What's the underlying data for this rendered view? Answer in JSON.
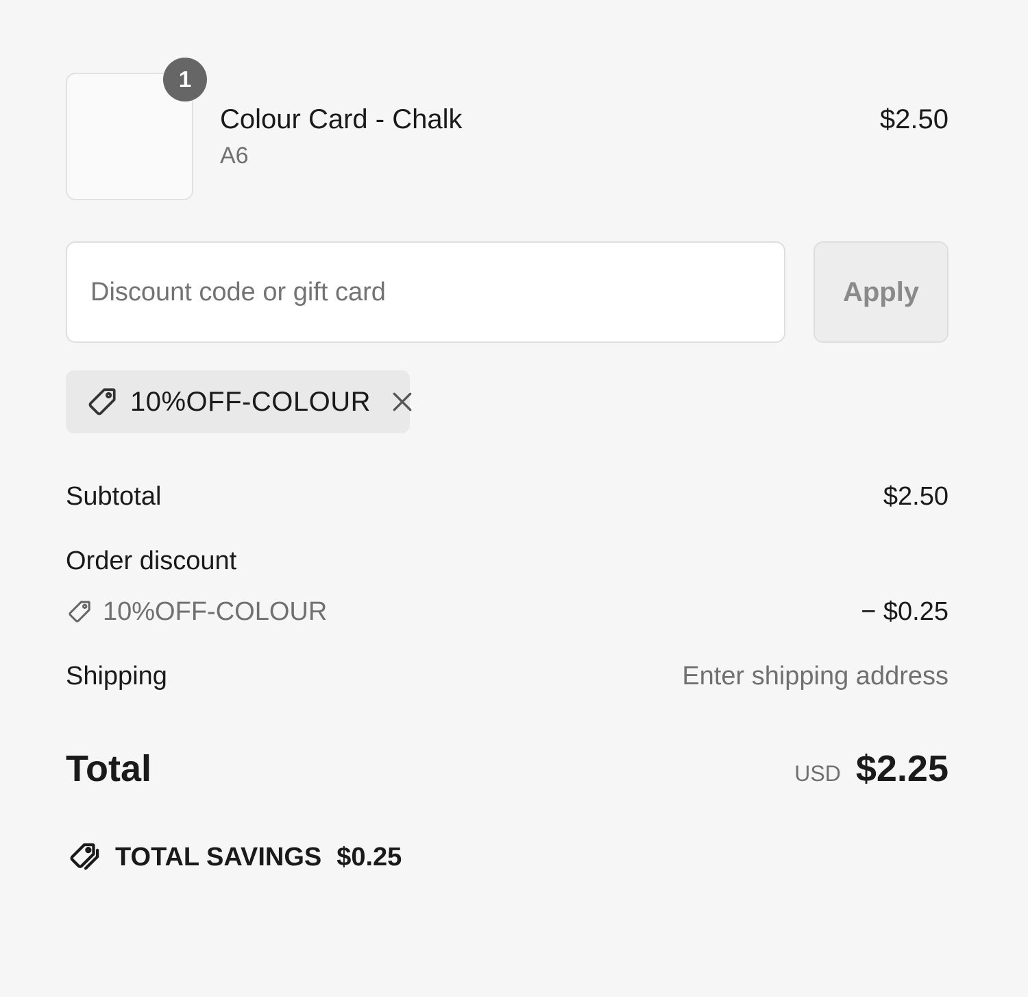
{
  "line_item": {
    "quantity": "1",
    "title": "Colour Card - Chalk",
    "variant": "A6",
    "price": "$2.50"
  },
  "discount_form": {
    "placeholder": "Discount code or gift card",
    "value": "",
    "apply_label": "Apply"
  },
  "applied_code": {
    "code": "10%OFF-COLOUR",
    "icon": "tag-icon",
    "remove_icon": "close-icon"
  },
  "totals": {
    "subtotal_label": "Subtotal",
    "subtotal_value": "$2.50",
    "order_discount_label": "Order discount",
    "order_discount_code": "10%OFF-COLOUR",
    "order_discount_value": "− $0.25",
    "shipping_label": "Shipping",
    "shipping_value": "Enter shipping address",
    "total_label": "Total",
    "currency": "USD",
    "total_value": "$2.25"
  },
  "savings": {
    "label": "TOTAL SAVINGS",
    "value": "$0.25",
    "icon": "double-tag-icon"
  },
  "colors": {
    "background": "#f6f6f6",
    "text": "#1a1a1a",
    "muted_text": "#707070",
    "badge": "#666666",
    "chip_background": "#e9e9e9",
    "apply_button_background": "#ededed"
  }
}
